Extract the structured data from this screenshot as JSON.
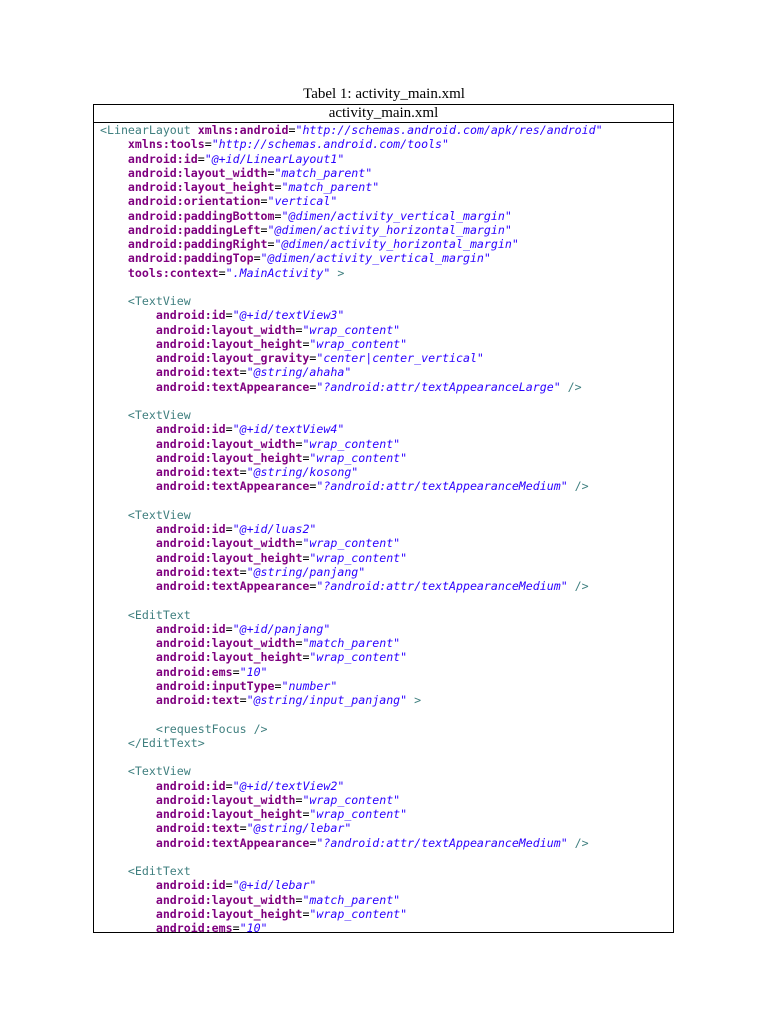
{
  "caption": "Tabel 1: activity_main.xml",
  "table_header": "activity_main.xml",
  "colors": {
    "tag": "#3f7f7f",
    "attr": "#7f007f",
    "val": "#2a00ff"
  },
  "code_lines": [
    {
      "indent": 0,
      "parts": [
        [
          "tag",
          "<LinearLayout "
        ],
        [
          "attr",
          "xmlns:android"
        ],
        [
          "plain",
          "="
        ],
        [
          "val",
          "\"http://schemas.android.com/apk/res/android\""
        ]
      ]
    },
    {
      "indent": 1,
      "parts": [
        [
          "attr",
          "xmlns:tools"
        ],
        [
          "plain",
          "="
        ],
        [
          "val",
          "\"http://schemas.android.com/tools\""
        ]
      ]
    },
    {
      "indent": 1,
      "parts": [
        [
          "attr",
          "android:id"
        ],
        [
          "plain",
          "="
        ],
        [
          "val",
          "\"@+id/LinearLayout1\""
        ]
      ]
    },
    {
      "indent": 1,
      "parts": [
        [
          "attr",
          "android:layout_width"
        ],
        [
          "plain",
          "="
        ],
        [
          "val",
          "\"match_parent\""
        ]
      ]
    },
    {
      "indent": 1,
      "parts": [
        [
          "attr",
          "android:layout_height"
        ],
        [
          "plain",
          "="
        ],
        [
          "val",
          "\"match_parent\""
        ]
      ]
    },
    {
      "indent": 1,
      "parts": [
        [
          "attr",
          "android:orientation"
        ],
        [
          "plain",
          "="
        ],
        [
          "val",
          "\"vertical\""
        ]
      ]
    },
    {
      "indent": 1,
      "parts": [
        [
          "attr",
          "android:paddingBottom"
        ],
        [
          "plain",
          "="
        ],
        [
          "val",
          "\"@dimen/activity_vertical_margin\""
        ]
      ]
    },
    {
      "indent": 1,
      "parts": [
        [
          "attr",
          "android:paddingLeft"
        ],
        [
          "plain",
          "="
        ],
        [
          "val",
          "\"@dimen/activity_horizontal_margin\""
        ]
      ]
    },
    {
      "indent": 1,
      "parts": [
        [
          "attr",
          "android:paddingRight"
        ],
        [
          "plain",
          "="
        ],
        [
          "val",
          "\"@dimen/activity_horizontal_margin\""
        ]
      ]
    },
    {
      "indent": 1,
      "parts": [
        [
          "attr",
          "android:paddingTop"
        ],
        [
          "plain",
          "="
        ],
        [
          "val",
          "\"@dimen/activity_vertical_margin\""
        ]
      ]
    },
    {
      "indent": 1,
      "parts": [
        [
          "attr",
          "tools:context"
        ],
        [
          "plain",
          "="
        ],
        [
          "val",
          "\".MainActivity\""
        ],
        [
          "tag",
          " >"
        ]
      ]
    },
    {
      "indent": 0,
      "parts": []
    },
    {
      "indent": 1,
      "parts": [
        [
          "tag",
          "<TextView"
        ]
      ]
    },
    {
      "indent": 2,
      "parts": [
        [
          "attr",
          "android:id"
        ],
        [
          "plain",
          "="
        ],
        [
          "val",
          "\"@+id/textView3\""
        ]
      ]
    },
    {
      "indent": 2,
      "parts": [
        [
          "attr",
          "android:layout_width"
        ],
        [
          "plain",
          "="
        ],
        [
          "val",
          "\"wrap_content\""
        ]
      ]
    },
    {
      "indent": 2,
      "parts": [
        [
          "attr",
          "android:layout_height"
        ],
        [
          "plain",
          "="
        ],
        [
          "val",
          "\"wrap_content\""
        ]
      ]
    },
    {
      "indent": 2,
      "parts": [
        [
          "attr",
          "android:layout_gravity"
        ],
        [
          "plain",
          "="
        ],
        [
          "val",
          "\"center|center_vertical\""
        ]
      ]
    },
    {
      "indent": 2,
      "parts": [
        [
          "attr",
          "android:text"
        ],
        [
          "plain",
          "="
        ],
        [
          "val",
          "\"@string/ahaha\""
        ]
      ]
    },
    {
      "indent": 2,
      "parts": [
        [
          "attr",
          "android:textAppearance"
        ],
        [
          "plain",
          "="
        ],
        [
          "val",
          "\"?android:attr/textAppearanceLarge\""
        ],
        [
          "tag",
          " />"
        ]
      ]
    },
    {
      "indent": 0,
      "parts": []
    },
    {
      "indent": 1,
      "parts": [
        [
          "tag",
          "<TextView"
        ]
      ]
    },
    {
      "indent": 2,
      "parts": [
        [
          "attr",
          "android:id"
        ],
        [
          "plain",
          "="
        ],
        [
          "val",
          "\"@+id/textView4\""
        ]
      ]
    },
    {
      "indent": 2,
      "parts": [
        [
          "attr",
          "android:layout_width"
        ],
        [
          "plain",
          "="
        ],
        [
          "val",
          "\"wrap_content\""
        ]
      ]
    },
    {
      "indent": 2,
      "parts": [
        [
          "attr",
          "android:layout_height"
        ],
        [
          "plain",
          "="
        ],
        [
          "val",
          "\"wrap_content\""
        ]
      ]
    },
    {
      "indent": 2,
      "parts": [
        [
          "attr",
          "android:text"
        ],
        [
          "plain",
          "="
        ],
        [
          "val",
          "\"@string/kosong\""
        ]
      ]
    },
    {
      "indent": 2,
      "parts": [
        [
          "attr",
          "android:textAppearance"
        ],
        [
          "plain",
          "="
        ],
        [
          "val",
          "\"?android:attr/textAppearanceMedium\""
        ],
        [
          "tag",
          " />"
        ]
      ]
    },
    {
      "indent": 0,
      "parts": []
    },
    {
      "indent": 1,
      "parts": [
        [
          "tag",
          "<TextView"
        ]
      ]
    },
    {
      "indent": 2,
      "parts": [
        [
          "attr",
          "android:id"
        ],
        [
          "plain",
          "="
        ],
        [
          "val",
          "\"@+id/luas2\""
        ]
      ]
    },
    {
      "indent": 2,
      "parts": [
        [
          "attr",
          "android:layout_width"
        ],
        [
          "plain",
          "="
        ],
        [
          "val",
          "\"wrap_content\""
        ]
      ]
    },
    {
      "indent": 2,
      "parts": [
        [
          "attr",
          "android:layout_height"
        ],
        [
          "plain",
          "="
        ],
        [
          "val",
          "\"wrap_content\""
        ]
      ]
    },
    {
      "indent": 2,
      "parts": [
        [
          "attr",
          "android:text"
        ],
        [
          "plain",
          "="
        ],
        [
          "val",
          "\"@string/panjang\""
        ]
      ]
    },
    {
      "indent": 2,
      "parts": [
        [
          "attr",
          "android:textAppearance"
        ],
        [
          "plain",
          "="
        ],
        [
          "val",
          "\"?android:attr/textAppearanceMedium\""
        ],
        [
          "tag",
          " />"
        ]
      ]
    },
    {
      "indent": 0,
      "parts": []
    },
    {
      "indent": 1,
      "parts": [
        [
          "tag",
          "<EditText"
        ]
      ]
    },
    {
      "indent": 2,
      "parts": [
        [
          "attr",
          "android:id"
        ],
        [
          "plain",
          "="
        ],
        [
          "val",
          "\"@+id/panjang\""
        ]
      ]
    },
    {
      "indent": 2,
      "parts": [
        [
          "attr",
          "android:layout_width"
        ],
        [
          "plain",
          "="
        ],
        [
          "val",
          "\"match_parent\""
        ]
      ]
    },
    {
      "indent": 2,
      "parts": [
        [
          "attr",
          "android:layout_height"
        ],
        [
          "plain",
          "="
        ],
        [
          "val",
          "\"wrap_content\""
        ]
      ]
    },
    {
      "indent": 2,
      "parts": [
        [
          "attr",
          "android:ems"
        ],
        [
          "plain",
          "="
        ],
        [
          "val",
          "\"10\""
        ]
      ]
    },
    {
      "indent": 2,
      "parts": [
        [
          "attr",
          "android:inputType"
        ],
        [
          "plain",
          "="
        ],
        [
          "val",
          "\"number\""
        ]
      ]
    },
    {
      "indent": 2,
      "parts": [
        [
          "attr",
          "android:text"
        ],
        [
          "plain",
          "="
        ],
        [
          "val",
          "\"@string/input_panjang\""
        ],
        [
          "tag",
          " >"
        ]
      ]
    },
    {
      "indent": 0,
      "parts": []
    },
    {
      "indent": 2,
      "parts": [
        [
          "tag",
          "<requestFocus />"
        ]
      ]
    },
    {
      "indent": 1,
      "parts": [
        [
          "tag",
          "</EditText>"
        ]
      ]
    },
    {
      "indent": 0,
      "parts": []
    },
    {
      "indent": 1,
      "parts": [
        [
          "tag",
          "<TextView"
        ]
      ]
    },
    {
      "indent": 2,
      "parts": [
        [
          "attr",
          "android:id"
        ],
        [
          "plain",
          "="
        ],
        [
          "val",
          "\"@+id/textView2\""
        ]
      ]
    },
    {
      "indent": 2,
      "parts": [
        [
          "attr",
          "android:layout_width"
        ],
        [
          "plain",
          "="
        ],
        [
          "val",
          "\"wrap_content\""
        ]
      ]
    },
    {
      "indent": 2,
      "parts": [
        [
          "attr",
          "android:layout_height"
        ],
        [
          "plain",
          "="
        ],
        [
          "val",
          "\"wrap_content\""
        ]
      ]
    },
    {
      "indent": 2,
      "parts": [
        [
          "attr",
          "android:text"
        ],
        [
          "plain",
          "="
        ],
        [
          "val",
          "\"@string/lebar\""
        ]
      ]
    },
    {
      "indent": 2,
      "parts": [
        [
          "attr",
          "android:textAppearance"
        ],
        [
          "plain",
          "="
        ],
        [
          "val",
          "\"?android:attr/textAppearanceMedium\""
        ],
        [
          "tag",
          " />"
        ]
      ]
    },
    {
      "indent": 0,
      "parts": []
    },
    {
      "indent": 1,
      "parts": [
        [
          "tag",
          "<EditText"
        ]
      ]
    },
    {
      "indent": 2,
      "parts": [
        [
          "attr",
          "android:id"
        ],
        [
          "plain",
          "="
        ],
        [
          "val",
          "\"@+id/lebar\""
        ]
      ]
    },
    {
      "indent": 2,
      "parts": [
        [
          "attr",
          "android:layout_width"
        ],
        [
          "plain",
          "="
        ],
        [
          "val",
          "\"match_parent\""
        ]
      ]
    },
    {
      "indent": 2,
      "parts": [
        [
          "attr",
          "android:layout_height"
        ],
        [
          "plain",
          "="
        ],
        [
          "val",
          "\"wrap_content\""
        ]
      ]
    },
    {
      "indent": 2,
      "parts": [
        [
          "attr",
          "android:ems"
        ],
        [
          "plain",
          "="
        ],
        [
          "val",
          "\"10\""
        ]
      ]
    }
  ]
}
